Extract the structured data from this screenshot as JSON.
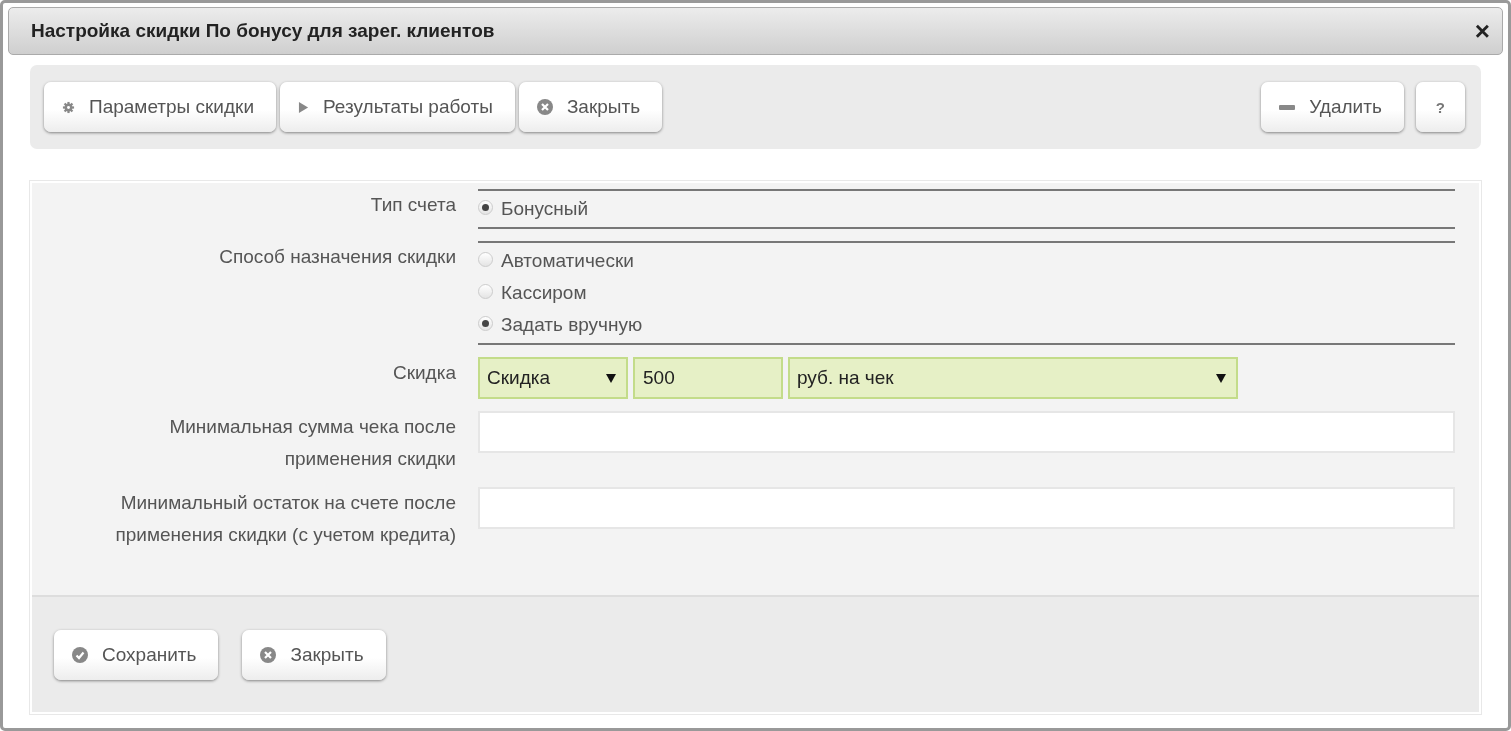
{
  "window": {
    "title": "Настройка скидки По бонусу для зарег. клиентов",
    "close": "×"
  },
  "toolbar": {
    "left": [
      {
        "kind": "settings",
        "label": "Параметры скидки"
      },
      {
        "kind": "play",
        "label": "Результаты работы"
      },
      {
        "kind": "close",
        "label": "Закрыть"
      }
    ],
    "right": [
      {
        "kind": "delete",
        "label": "Удалить"
      },
      {
        "kind": "text",
        "label": "?"
      }
    ]
  },
  "form": {
    "rows": [
      {
        "kind": "radio",
        "label": "Тип счета",
        "options": [
          {
            "label": "Бонусный",
            "selected": true
          }
        ]
      },
      {
        "kind": "radio",
        "label": "Способ назначения скидки",
        "options": [
          {
            "label": "Автоматически",
            "selected": false
          },
          {
            "label": "Кассиром",
            "selected": false
          },
          {
            "label": "Задать вручную",
            "selected": true
          }
        ]
      },
      {
        "kind": "discount",
        "label": "Скидка",
        "type_select": "Скидка",
        "amount": "500",
        "unit_select": "руб. на чек"
      },
      {
        "kind": "input",
        "label": "Минимальная сумма чека после применения скидки"
      },
      {
        "kind": "input",
        "label": "Минимальный остаток на счете после применения скидки (с учетом кредита)"
      }
    ]
  },
  "footer": {
    "buttons": [
      {
        "kind": "save",
        "label": "Сохранить"
      },
      {
        "kind": "close",
        "label": "Закрыть"
      }
    ]
  }
}
